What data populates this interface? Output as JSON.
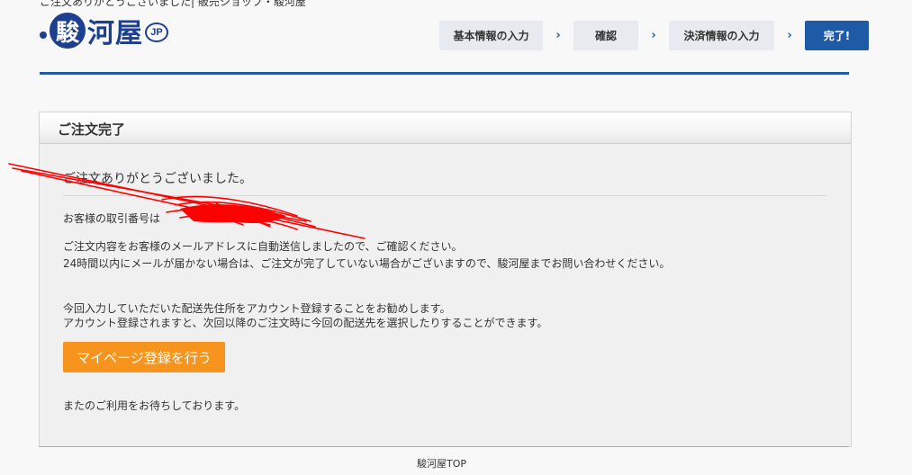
{
  "header": {
    "page_title": "ご注文ありがとうございました| 販売ショップ・駿河屋",
    "logo": {
      "mark": "駿",
      "text": "河屋",
      "jp": "JP"
    }
  },
  "steps": [
    {
      "label": "基本情報の入力"
    },
    {
      "label": "確認"
    },
    {
      "label": "決済情報の入力"
    },
    {
      "label": "完了!"
    }
  ],
  "step_arrow": "›",
  "panel": {
    "title": "ご注文完了",
    "thanks": "ご注文ありがとうございました。",
    "transaction_label": "お客様の取引番号は",
    "email_notice_1": "ご注文内容をお客様のメールアドレスに自動送信しましたので、ご確認ください。",
    "email_notice_2": "24時間以内にメールが届かない場合は、ご注文が完了していない場合がございますので、駿河屋までお問い合わせください。",
    "account_notice_1": "今回入力していただいた配送先住所をアカウント登録することをお勧めします。",
    "account_notice_2": "アカウント登録されますと、次回以降のご注文時に今回の配送先を選択したりすることができます。",
    "mypage_button": "マイページ登録を行う",
    "closing": "またのご利用をお待ちしております。"
  },
  "footer": {
    "top_link": "駿河屋TOP"
  },
  "colors": {
    "accent": "#1e5aa6",
    "button": "#f7941d",
    "annotation": "#ff0000"
  }
}
